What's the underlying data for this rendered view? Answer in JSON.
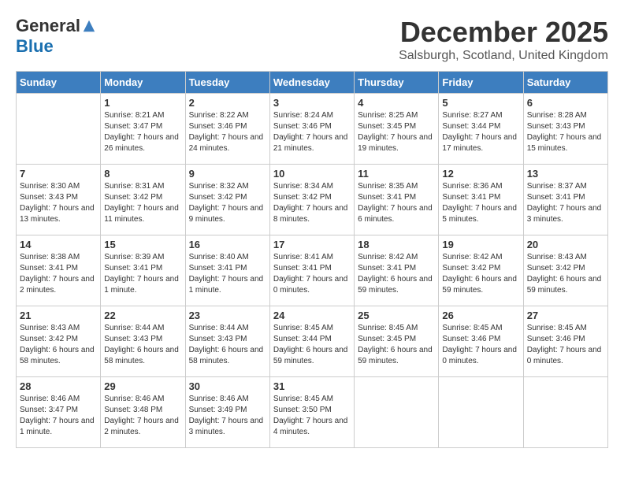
{
  "header": {
    "logo_general": "General",
    "logo_blue": "Blue",
    "month_title": "December 2025",
    "location": "Salsburgh, Scotland, United Kingdom"
  },
  "days_of_week": [
    "Sunday",
    "Monday",
    "Tuesday",
    "Wednesday",
    "Thursday",
    "Friday",
    "Saturday"
  ],
  "weeks": [
    [
      {
        "day": "",
        "sunrise": "",
        "sunset": "",
        "daylight": ""
      },
      {
        "day": "1",
        "sunrise": "Sunrise: 8:21 AM",
        "sunset": "Sunset: 3:47 PM",
        "daylight": "Daylight: 7 hours and 26 minutes."
      },
      {
        "day": "2",
        "sunrise": "Sunrise: 8:22 AM",
        "sunset": "Sunset: 3:46 PM",
        "daylight": "Daylight: 7 hours and 24 minutes."
      },
      {
        "day": "3",
        "sunrise": "Sunrise: 8:24 AM",
        "sunset": "Sunset: 3:46 PM",
        "daylight": "Daylight: 7 hours and 21 minutes."
      },
      {
        "day": "4",
        "sunrise": "Sunrise: 8:25 AM",
        "sunset": "Sunset: 3:45 PM",
        "daylight": "Daylight: 7 hours and 19 minutes."
      },
      {
        "day": "5",
        "sunrise": "Sunrise: 8:27 AM",
        "sunset": "Sunset: 3:44 PM",
        "daylight": "Daylight: 7 hours and 17 minutes."
      },
      {
        "day": "6",
        "sunrise": "Sunrise: 8:28 AM",
        "sunset": "Sunset: 3:43 PM",
        "daylight": "Daylight: 7 hours and 15 minutes."
      }
    ],
    [
      {
        "day": "7",
        "sunrise": "Sunrise: 8:30 AM",
        "sunset": "Sunset: 3:43 PM",
        "daylight": "Daylight: 7 hours and 13 minutes."
      },
      {
        "day": "8",
        "sunrise": "Sunrise: 8:31 AM",
        "sunset": "Sunset: 3:42 PM",
        "daylight": "Daylight: 7 hours and 11 minutes."
      },
      {
        "day": "9",
        "sunrise": "Sunrise: 8:32 AM",
        "sunset": "Sunset: 3:42 PM",
        "daylight": "Daylight: 7 hours and 9 minutes."
      },
      {
        "day": "10",
        "sunrise": "Sunrise: 8:34 AM",
        "sunset": "Sunset: 3:42 PM",
        "daylight": "Daylight: 7 hours and 8 minutes."
      },
      {
        "day": "11",
        "sunrise": "Sunrise: 8:35 AM",
        "sunset": "Sunset: 3:41 PM",
        "daylight": "Daylight: 7 hours and 6 minutes."
      },
      {
        "day": "12",
        "sunrise": "Sunrise: 8:36 AM",
        "sunset": "Sunset: 3:41 PM",
        "daylight": "Daylight: 7 hours and 5 minutes."
      },
      {
        "day": "13",
        "sunrise": "Sunrise: 8:37 AM",
        "sunset": "Sunset: 3:41 PM",
        "daylight": "Daylight: 7 hours and 3 minutes."
      }
    ],
    [
      {
        "day": "14",
        "sunrise": "Sunrise: 8:38 AM",
        "sunset": "Sunset: 3:41 PM",
        "daylight": "Daylight: 7 hours and 2 minutes."
      },
      {
        "day": "15",
        "sunrise": "Sunrise: 8:39 AM",
        "sunset": "Sunset: 3:41 PM",
        "daylight": "Daylight: 7 hours and 1 minute."
      },
      {
        "day": "16",
        "sunrise": "Sunrise: 8:40 AM",
        "sunset": "Sunset: 3:41 PM",
        "daylight": "Daylight: 7 hours and 1 minute."
      },
      {
        "day": "17",
        "sunrise": "Sunrise: 8:41 AM",
        "sunset": "Sunset: 3:41 PM",
        "daylight": "Daylight: 7 hours and 0 minutes."
      },
      {
        "day": "18",
        "sunrise": "Sunrise: 8:42 AM",
        "sunset": "Sunset: 3:41 PM",
        "daylight": "Daylight: 6 hours and 59 minutes."
      },
      {
        "day": "19",
        "sunrise": "Sunrise: 8:42 AM",
        "sunset": "Sunset: 3:42 PM",
        "daylight": "Daylight: 6 hours and 59 minutes."
      },
      {
        "day": "20",
        "sunrise": "Sunrise: 8:43 AM",
        "sunset": "Sunset: 3:42 PM",
        "daylight": "Daylight: 6 hours and 59 minutes."
      }
    ],
    [
      {
        "day": "21",
        "sunrise": "Sunrise: 8:43 AM",
        "sunset": "Sunset: 3:42 PM",
        "daylight": "Daylight: 6 hours and 58 minutes."
      },
      {
        "day": "22",
        "sunrise": "Sunrise: 8:44 AM",
        "sunset": "Sunset: 3:43 PM",
        "daylight": "Daylight: 6 hours and 58 minutes."
      },
      {
        "day": "23",
        "sunrise": "Sunrise: 8:44 AM",
        "sunset": "Sunset: 3:43 PM",
        "daylight": "Daylight: 6 hours and 58 minutes."
      },
      {
        "day": "24",
        "sunrise": "Sunrise: 8:45 AM",
        "sunset": "Sunset: 3:44 PM",
        "daylight": "Daylight: 6 hours and 59 minutes."
      },
      {
        "day": "25",
        "sunrise": "Sunrise: 8:45 AM",
        "sunset": "Sunset: 3:45 PM",
        "daylight": "Daylight: 6 hours and 59 minutes."
      },
      {
        "day": "26",
        "sunrise": "Sunrise: 8:45 AM",
        "sunset": "Sunset: 3:46 PM",
        "daylight": "Daylight: 7 hours and 0 minutes."
      },
      {
        "day": "27",
        "sunrise": "Sunrise: 8:45 AM",
        "sunset": "Sunset: 3:46 PM",
        "daylight": "Daylight: 7 hours and 0 minutes."
      }
    ],
    [
      {
        "day": "28",
        "sunrise": "Sunrise: 8:46 AM",
        "sunset": "Sunset: 3:47 PM",
        "daylight": "Daylight: 7 hours and 1 minute."
      },
      {
        "day": "29",
        "sunrise": "Sunrise: 8:46 AM",
        "sunset": "Sunset: 3:48 PM",
        "daylight": "Daylight: 7 hours and 2 minutes."
      },
      {
        "day": "30",
        "sunrise": "Sunrise: 8:46 AM",
        "sunset": "Sunset: 3:49 PM",
        "daylight": "Daylight: 7 hours and 3 minutes."
      },
      {
        "day": "31",
        "sunrise": "Sunrise: 8:45 AM",
        "sunset": "Sunset: 3:50 PM",
        "daylight": "Daylight: 7 hours and 4 minutes."
      },
      {
        "day": "",
        "sunrise": "",
        "sunset": "",
        "daylight": ""
      },
      {
        "day": "",
        "sunrise": "",
        "sunset": "",
        "daylight": ""
      },
      {
        "day": "",
        "sunrise": "",
        "sunset": "",
        "daylight": ""
      }
    ]
  ]
}
